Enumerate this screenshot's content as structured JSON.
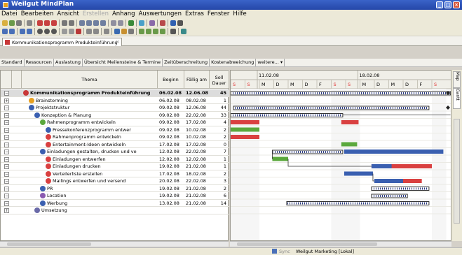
{
  "window": {
    "title": "Weilgut MindPlan"
  },
  "menu": {
    "items": [
      "Datei",
      "Bearbeiten",
      "Ansicht",
      "Erstellen",
      "Anhang",
      "Auswertungen",
      "Extras",
      "Fenster",
      "Hilfe"
    ],
    "disabled_label": "Erstellen"
  },
  "document_tab": {
    "label": "Kommunikationsprogramm Produkteinführung",
    "close": "×"
  },
  "view_tabs": [
    "Standard",
    "Ressourcen",
    "Auslastung",
    "Übersicht Meilensteine & Termine",
    "Zeitüberschreitung",
    "Kostenabweichung",
    "weitere... ▾"
  ],
  "table": {
    "headers": {
      "thema": "Thema",
      "beginn": "Beginn",
      "faellig": "Fällig am",
      "soll": "Soll Dauer"
    },
    "rows": [
      {
        "title": "Kommunikationsprogramm Produkteinführung",
        "begin": "06.02.08",
        "due": "12.06.08",
        "duration": "45",
        "bold": true
      },
      {
        "title": "Brainstorming",
        "begin": "06.02.08",
        "due": "08.02.08",
        "duration": "1"
      },
      {
        "title": "Projektstruktur",
        "begin": "09.02.08",
        "due": "12.06.08",
        "duration": "44"
      },
      {
        "title": "Konzeption & Planung",
        "begin": "09.02.08",
        "due": "22.02.08",
        "duration": "33"
      },
      {
        "title": "Rahmenprogramm entwickeln",
        "begin": "09.02.08",
        "due": "17.02.08",
        "duration": "4"
      },
      {
        "title": "Pressekonferenzprogramm entwer",
        "begin": "09.02.08",
        "due": "10.02.08",
        "duration": "2"
      },
      {
        "title": "Rahmenprogramm entwickeln",
        "begin": "09.02.08",
        "due": "10.02.08",
        "duration": "2"
      },
      {
        "title": "Entertainment-Ideen entwickeln",
        "begin": "17.02.08",
        "due": "17.02.08",
        "duration": "0"
      },
      {
        "title": "Einladungen gestalten, drucken und ve",
        "begin": "12.02.08",
        "due": "22.02.08",
        "duration": "7"
      },
      {
        "title": "Einladungen entwerfen",
        "begin": "12.02.08",
        "due": "12.02.08",
        "duration": "1"
      },
      {
        "title": "Einladungen drucken",
        "begin": "19.02.08",
        "due": "21.02.08",
        "duration": "1"
      },
      {
        "title": "Verteilerliste erstellen",
        "begin": "17.02.08",
        "due": "18.02.08",
        "duration": "2"
      },
      {
        "title": "Mailings entwerfen und versend",
        "begin": "20.02.08",
        "due": "22.02.08",
        "duration": "3"
      },
      {
        "title": "PR",
        "begin": "19.02.08",
        "due": "21.02.08",
        "duration": "2"
      },
      {
        "title": "Location",
        "begin": "19.02.08",
        "due": "21.02.08",
        "duration": "6"
      },
      {
        "title": "Werbung",
        "begin": "13.02.08",
        "due": "21.02.08",
        "duration": "14"
      },
      {
        "title": "Umsetzung",
        "begin": "",
        "due": "",
        "duration": ""
      }
    ]
  },
  "gantt": {
    "weeks": [
      "11.02.08",
      "18.02.08"
    ],
    "days": [
      "S",
      "S",
      "M",
      "D",
      "M",
      "D",
      "F",
      "S",
      "S",
      "M",
      "D",
      "M",
      "D",
      "F",
      "S"
    ],
    "weekend_color": "#e03030"
  },
  "side_tabs": {
    "map": "Map",
    "gantt": "Gantt"
  },
  "status": {
    "sync": "Sync",
    "project": "Weilgut Marketing [Lokal]"
  },
  "colors": {
    "title_bar": "#2547a8",
    "bar_red": "#d94040",
    "bar_green": "#5aa83c",
    "bar_blue": "#3a5fb0",
    "bar_summary": "#444444"
  }
}
